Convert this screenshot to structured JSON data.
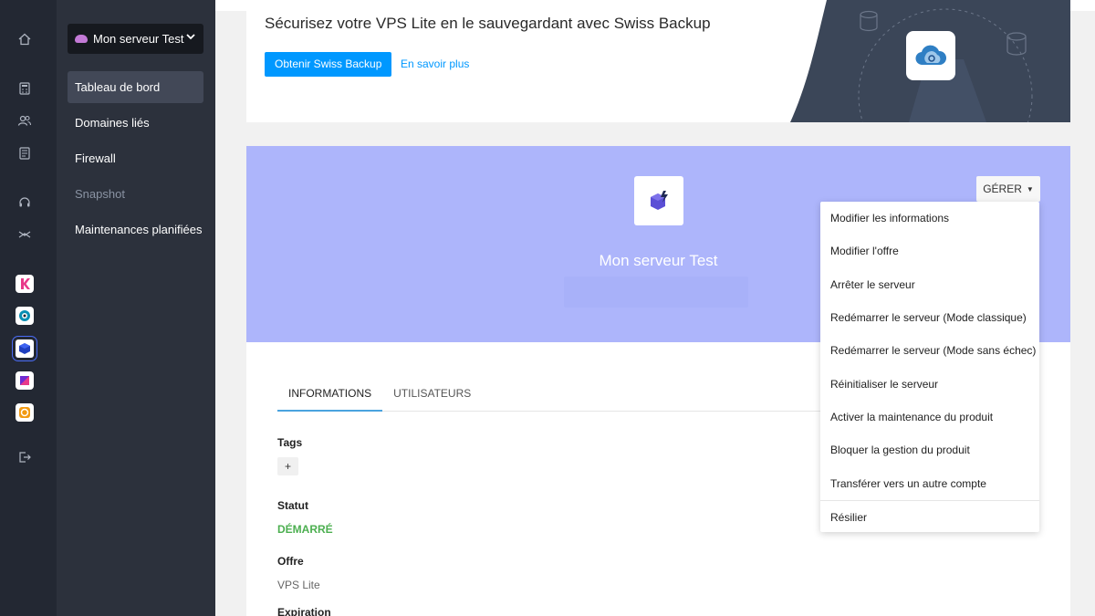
{
  "sidebar": {
    "server_name": "Mon serveur Test",
    "items": [
      {
        "label": "Tableau de bord"
      },
      {
        "label": "Domaines liés"
      },
      {
        "label": "Firewall"
      },
      {
        "label": "Snapshot"
      },
      {
        "label": "Maintenances planifiées"
      }
    ]
  },
  "banner": {
    "title": "Sécurisez votre VPS Lite en le sauvegardant avec Swiss Backup",
    "primary_button": "Obtenir Swiss Backup",
    "link": "En savoir plus"
  },
  "hero": {
    "server_name": "Mon serveur Test",
    "manage_button": "GÉRER"
  },
  "tabs": [
    "INFORMATIONS",
    "UTILISATEURS"
  ],
  "details": {
    "tags_label": "Tags",
    "tags_add": "+",
    "status_label": "Statut",
    "status_value": "DÉMARRÉ",
    "offer_label": "Offre",
    "offer_value": "VPS Lite",
    "expiration_label": "Expiration"
  },
  "manage_menu": [
    "Modifier les informations",
    "Modifier l'offre",
    "Arrêter le serveur",
    "Redémarrer le serveur (Mode classique)",
    "Redémarrer le serveur (Mode sans échec)",
    "Réinitialiser le serveur",
    "Activer la maintenance du produit",
    "Bloquer la gestion du produit",
    "Transférer vers un autre compte",
    "Résilier"
  ],
  "colors": {
    "rail_bg": "#232833",
    "sidebar_bg": "#2c313c",
    "accent": "#0098ff",
    "hero_bg": "#adb5fb",
    "status_green": "#4caf50",
    "banner_dark": "#3b4658"
  },
  "icons": [
    "home-icon",
    "calculator-icon",
    "users-icon",
    "billing-icon",
    "support-icon",
    "network-icon",
    "kchat-app-icon",
    "kdrive-app-icon",
    "vps-app-icon",
    "kmeet-app-icon",
    "infomaniak-app-icon",
    "logout-icon",
    "cloud-icon",
    "chevron-down-icon"
  ]
}
